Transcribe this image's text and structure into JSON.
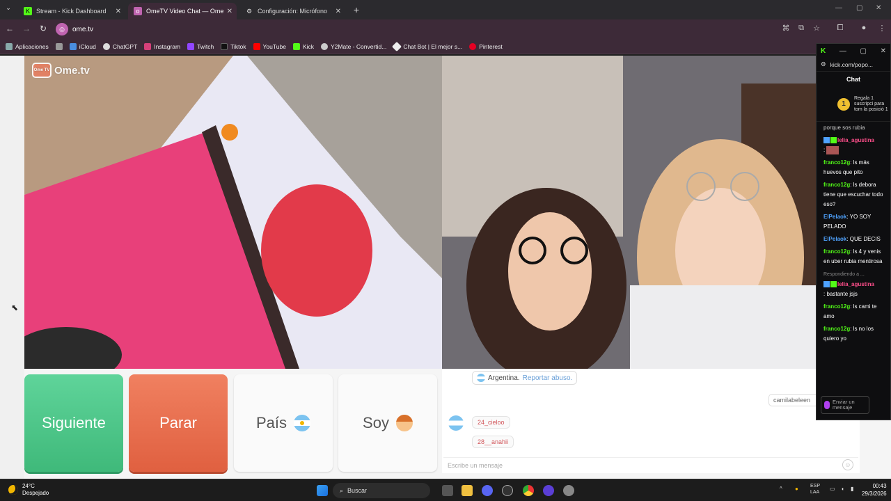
{
  "browser": {
    "tabs": [
      {
        "title": "Stream - Kick Dashboard",
        "icon": "kick-icon"
      },
      {
        "title": "OmeTV Video Chat — Ome",
        "icon": "ometv-icon"
      },
      {
        "title": "Configuración: Micrófono",
        "icon": "gear-icon"
      }
    ],
    "url": "ome.tv",
    "bookmarks": [
      "Aplicaciones",
      "iCloud",
      "ChatGPT",
      "Instagram",
      "Twitch",
      "Tiktok",
      "YouTube",
      "Kick",
      "Y2Mate - Convertid...",
      "Chat Bot | El mejor s...",
      "Pinterest"
    ]
  },
  "ometv": {
    "logo_text": "Ome.tv",
    "logo_badge": "Ome TV",
    "buttons": {
      "next": "Siguiente",
      "stop": "Parar",
      "country": "País",
      "me": "Soy"
    },
    "chat": {
      "report_country": "Argentina.",
      "report_link": "Reportar abuso.",
      "user_chips": [
        "24_cieloo",
        "28__anahii"
      ],
      "cami_chip": "camilabeleen",
      "placeholder": "Escribe un mensaje"
    }
  },
  "kick": {
    "url": "kick.com/popo...",
    "title": "Chat",
    "gift_count": "1",
    "gift_text": "Regala 1 suscripci para tom la posició 1",
    "top_fragment": "porque sos rubia",
    "messages": [
      {
        "user": "lelia_agustina",
        "text": ":"
      },
      {
        "user": "franco12g",
        "text": ": ls más huevos que pito"
      },
      {
        "user": "franco12g",
        "text": ": ls debora tiene que escuchar todo eso?"
      },
      {
        "user": "ElPelaok",
        "text": ": YO SOY PELADO"
      },
      {
        "user": "ElPelaok",
        "text": ": QUE DECIS"
      },
      {
        "user": "franco12g",
        "text": ": ls 4 y venis en uber rubia mentirosa"
      },
      {
        "reply": "Respondiendo a ...",
        "user": "lelia_agustina",
        "text": ": bastante jsjs"
      },
      {
        "user": "franco12g",
        "text": ": ls cami te amo"
      },
      {
        "user": "franco12g",
        "text": ": ls no los quiero yo"
      }
    ],
    "input_placeholder": "Enviar un mensaje"
  },
  "taskbar": {
    "temp": "24°C",
    "weather": "Despejado",
    "search": "Buscar",
    "lang1": "ESP",
    "lang2": "LAA",
    "time": "00:43",
    "date": "29/3/2026"
  },
  "colors": {
    "next": "#4fc98a",
    "stop": "#e8704f",
    "kick_green": "#53fc18",
    "chrome_bg": "#3d2a38"
  }
}
